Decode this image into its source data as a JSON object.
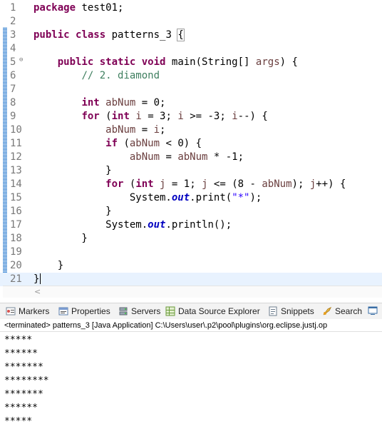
{
  "editor": {
    "lines": [
      {
        "n": "1",
        "html": "<span class=\"kw\">package</span> test01;"
      },
      {
        "n": "2",
        "html": ""
      },
      {
        "n": "3",
        "html": "<span class=\"kw\">public</span> <span class=\"kw\">class</span> patterns_3 <span class=\"hl\">{</span>"
      },
      {
        "n": "4",
        "html": ""
      },
      {
        "n": "5",
        "html": "    <span class=\"kw\">public</span> <span class=\"kw\">static</span> <span class=\"kw\">void</span> main(String[] <span class=\"var\">args</span>) {",
        "fold": true
      },
      {
        "n": "6",
        "html": "        <span class=\"cm\">// 2. diamond</span>"
      },
      {
        "n": "7",
        "html": ""
      },
      {
        "n": "8",
        "html": "        <span class=\"kw\">int</span> <span class=\"var\">abNum</span> = 0;"
      },
      {
        "n": "9",
        "html": "        <span class=\"kw\">for</span> (<span class=\"kw\">int</span> <span class=\"var\">i</span> = 3; <span class=\"var\">i</span> >= -3; <span class=\"var\">i</span>--) {"
      },
      {
        "n": "10",
        "html": "            <span class=\"var\">abNum</span> = <span class=\"var\">i</span>;"
      },
      {
        "n": "11",
        "html": "            <span class=\"kw\">if</span> (<span class=\"var\">abNum</span> < 0) {"
      },
      {
        "n": "12",
        "html": "                <span class=\"var\">abNum</span> = <span class=\"var\">abNum</span> * -1;"
      },
      {
        "n": "13",
        "html": "            }"
      },
      {
        "n": "14",
        "html": "            <span class=\"kw\">for</span> (<span class=\"kw\">int</span> <span class=\"var\">j</span> = 1; <span class=\"var\">j</span> <= (8 - <span class=\"var\">abNum</span>); <span class=\"var\">j</span>++) {"
      },
      {
        "n": "15",
        "html": "                System.<span class=\"fld\">out</span>.print(<span class=\"st\">\"*\"</span>);"
      },
      {
        "n": "16",
        "html": "            }"
      },
      {
        "n": "17",
        "html": "            System.<span class=\"fld\">out</span>.println();"
      },
      {
        "n": "18",
        "html": "        }"
      },
      {
        "n": "19",
        "html": ""
      },
      {
        "n": "20",
        "html": "    }"
      },
      {
        "n": "21",
        "html": "}",
        "current": true
      }
    ]
  },
  "views": {
    "tabs": [
      {
        "label": "Markers",
        "icon": "markers-icon"
      },
      {
        "label": "Properties",
        "icon": "properties-icon"
      },
      {
        "label": "Servers",
        "icon": "servers-icon"
      },
      {
        "label": "Data Source Explorer",
        "icon": "data-source-icon"
      },
      {
        "label": "Snippets",
        "icon": "snippets-icon"
      },
      {
        "label": "Search",
        "icon": "search-icon"
      }
    ],
    "console_header": "<terminated> patterns_3 [Java Application] C:\\Users\\user\\.p2\\pool\\plugins\\org.eclipse.justj.op"
  },
  "console": {
    "output": [
      "*****",
      "******",
      "*******",
      "********",
      "*******",
      "******",
      "*****"
    ]
  }
}
